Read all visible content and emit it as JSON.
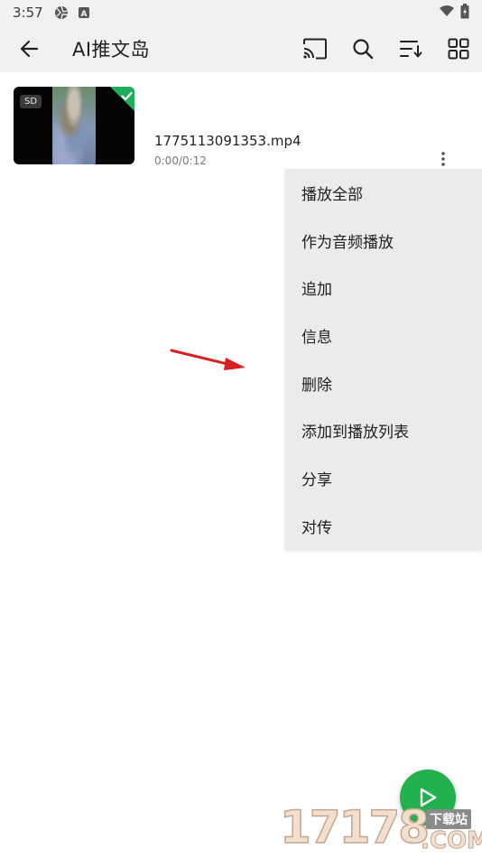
{
  "status_bar": {
    "time": "3:57"
  },
  "app_bar": {
    "title": "AI推文岛",
    "icons": [
      "arrow-back-icon",
      "cast-icon",
      "search-icon",
      "sort-icon",
      "grid-view-icon"
    ]
  },
  "video": {
    "badge": "SD",
    "filename": "1775113091353.mp4",
    "duration": "0:00/0:12",
    "selected": true
  },
  "menu": {
    "items": [
      {
        "label": "播放全部"
      },
      {
        "label": "作为音频播放"
      },
      {
        "label": "追加"
      },
      {
        "label": "信息"
      },
      {
        "label": "删除"
      },
      {
        "label": "添加到播放列表"
      },
      {
        "label": "分享"
      },
      {
        "label": "对传"
      }
    ]
  },
  "watermark": {
    "number": "17178",
    "tag": "下载站",
    "suffix": ".COM"
  },
  "colors": {
    "bar_background": "#f1f1f1",
    "menu_background": "#ebebeb",
    "accent_green": "#22b14c",
    "annotation_red": "#d81e1e"
  }
}
